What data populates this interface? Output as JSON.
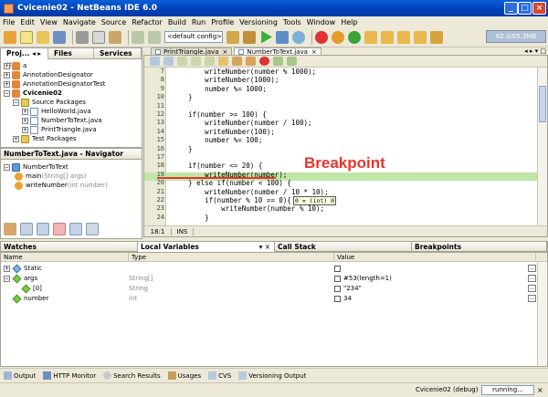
{
  "window": {
    "title": "Cvicenie02 - NetBeans IDE 6.0",
    "min": "_",
    "max": "□",
    "close": "×"
  },
  "menu": [
    "File",
    "Edit",
    "View",
    "Navigate",
    "Source",
    "Refactor",
    "Build",
    "Run",
    "Profile",
    "Versioning",
    "Tools",
    "Window",
    "Help"
  ],
  "toolbar": {
    "config": "<default config>",
    "memory": "62.0/85.3MB"
  },
  "projects_panel": {
    "tabs": [
      "Proj...",
      "Files",
      "Services"
    ],
    "tree": [
      {
        "label": "a",
        "level": 0,
        "icon": "project-icon"
      },
      {
        "label": "AnnotationDesignator",
        "level": 0,
        "icon": "project-icon"
      },
      {
        "label": "AnnotationDesignatorTest",
        "level": 0,
        "icon": "project-icon"
      },
      {
        "label": "Cvicenie02",
        "level": 0,
        "icon": "project-icon",
        "bold": true
      },
      {
        "label": "Source Packages",
        "level": 1,
        "icon": "folder-icon"
      },
      {
        "label": "HelloWorld.java",
        "level": 2,
        "icon": "java-file-icon"
      },
      {
        "label": "NumberToText.java",
        "level": 2,
        "icon": "java-file-icon"
      },
      {
        "label": "PrintTriangle.java",
        "level": 2,
        "icon": "java-file-icon"
      },
      {
        "label": "Test Packages",
        "level": 1,
        "icon": "folder-icon"
      }
    ]
  },
  "navigator": {
    "title": "NumberToText.java - Navigator",
    "class_name": "NumberToText",
    "method1": "main",
    "method1_args": "(String[] args)",
    "method2": "writeNumber",
    "method2_args": "(int number)"
  },
  "editor": {
    "tabs": [
      "PrintTriangle.java",
      "NumberToText.java"
    ],
    "lines": [
      {
        "n": "7",
        "text": "        writeNumber(number % 1000);"
      },
      {
        "n": "8",
        "text": "        writeNumber(1000);"
      },
      {
        "n": "9",
        "text": "        number %= 1000;"
      },
      {
        "n": "10",
        "text": "    }"
      },
      {
        "n": "11",
        "text": ""
      },
      {
        "n": "12",
        "text": "    if(number >= 100) {"
      },
      {
        "n": "13",
        "text": "        writeNumber(number / 100);"
      },
      {
        "n": "14",
        "text": "        writeNumber(100);"
      },
      {
        "n": "15",
        "text": "        number %= 100;"
      },
      {
        "n": "16",
        "text": "    }"
      },
      {
        "n": "17",
        "text": ""
      },
      {
        "n": "18",
        "text": "    if(number <= 20) {"
      },
      {
        "n": "19",
        "text": "        writeNumber(number);"
      },
      {
        "n": "20",
        "text": "    } else if(number < 100) {"
      },
      {
        "n": "21",
        "text": "        writeNumber(number / 10 * 10);"
      },
      {
        "n": "22",
        "text": "        if(number % 10 == 0){"
      },
      {
        "n": "23",
        "text": "            writeNumber(number % 10);"
      },
      {
        "n": "24",
        "text": "        }"
      }
    ],
    "breakpoint_label": "Breakpoint",
    "tooltip": "0 = (int) 0",
    "position": "18:1",
    "mode": "INS"
  },
  "bottom_tabs": [
    "Watches",
    "Local Variables",
    "Call Stack",
    "Breakpoints"
  ],
  "variables": {
    "columns": [
      "Name",
      "Type",
      "Value"
    ],
    "rows": [
      {
        "name": "Static",
        "type": "",
        "value": "",
        "level": 0
      },
      {
        "name": "args",
        "type": "String[]",
        "value": "#53(length=1)",
        "level": 0
      },
      {
        "name": "[0]",
        "type": "String",
        "value": "\"234\"",
        "level": 1
      },
      {
        "name": "number",
        "type": "int",
        "value": "34",
        "level": 0
      }
    ]
  },
  "status_tabs": [
    "Output",
    "HTTP Monitor",
    "Search Results",
    "Usages",
    "CVS",
    "Versioning Output"
  ],
  "status": {
    "session": "Cvicenie02 (debug)",
    "progress": "running..."
  },
  "colors": {
    "breakpoint_line": "#bfe6a6",
    "breakpoint_label": "#e8332d",
    "keyword": "#0000e6"
  }
}
